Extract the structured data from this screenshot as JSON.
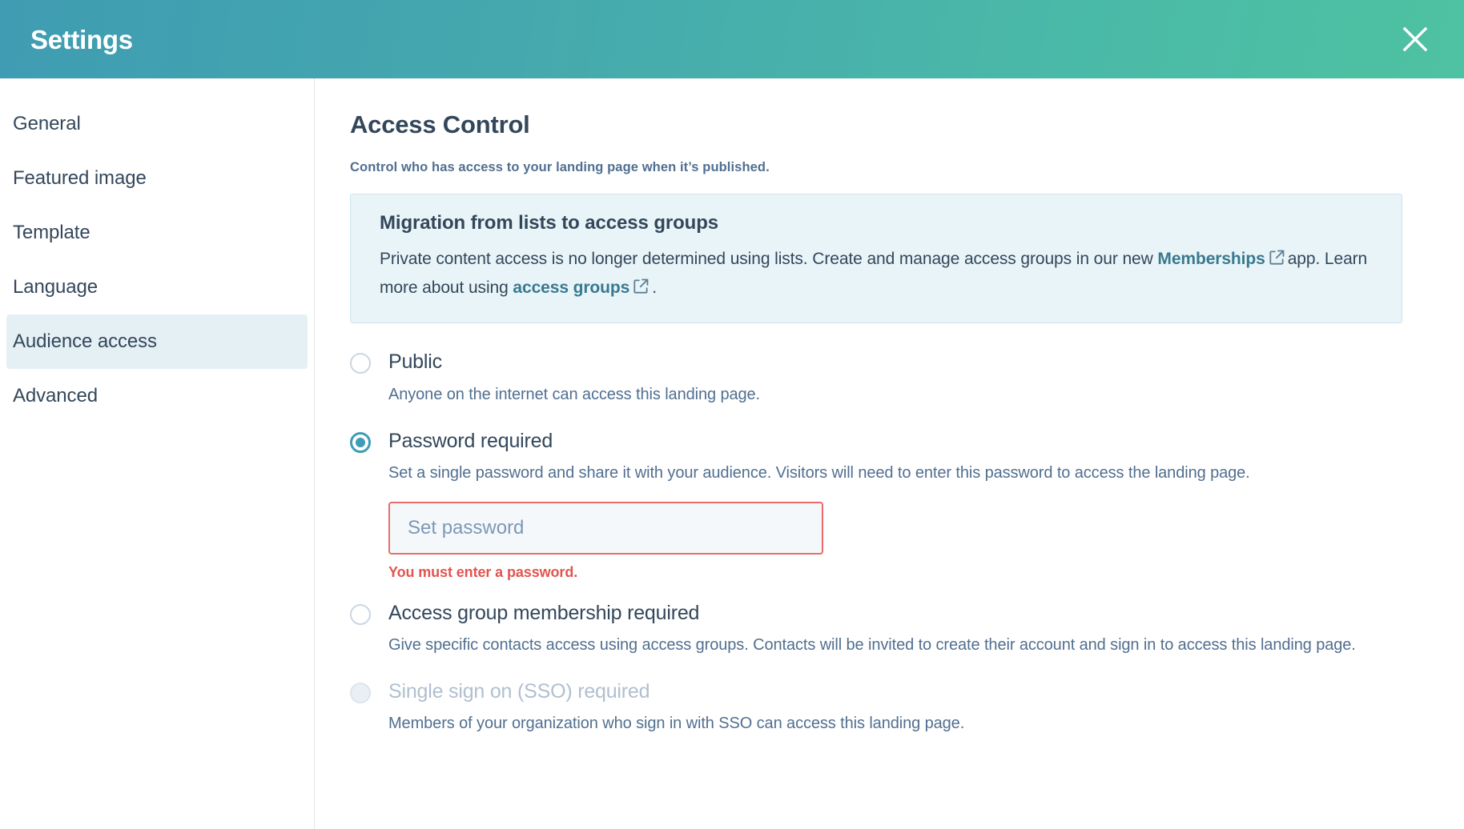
{
  "header": {
    "title": "Settings",
    "close_icon": "close-icon"
  },
  "sidebar": {
    "items": [
      {
        "label": "General",
        "active": false
      },
      {
        "label": "Featured image",
        "active": false
      },
      {
        "label": "Template",
        "active": false
      },
      {
        "label": "Language",
        "active": false
      },
      {
        "label": "Audience access",
        "active": true
      },
      {
        "label": "Advanced",
        "active": false
      }
    ]
  },
  "main": {
    "title": "Access Control",
    "subtitle": "Control who has access to your landing page when it’s published.",
    "banner": {
      "title": "Migration from lists to access groups",
      "text_part1": "Private content access is no longer determined using lists. Create and manage access groups in our new",
      "link1_label": "Memberships",
      "text_part2": "app. Learn more about using",
      "link2_label": "access groups",
      "text_part3": ".",
      "link_icon": "external-link-icon",
      "accent_color": "#39798f",
      "background_color": "#e8f4f7"
    },
    "options": [
      {
        "label": "Public",
        "description": "Anyone on the internet can access this landing page.",
        "selected": false,
        "disabled": false
      },
      {
        "label": "Password required",
        "description": "Set a single password and share it with your audience. Visitors will need to enter this password to access the landing page.",
        "selected": true,
        "disabled": false,
        "field": {
          "placeholder": "Set password",
          "value": "",
          "error": "You must enter a password.",
          "error_color": "#e2544f",
          "border_color": "#ea6b6b"
        }
      },
      {
        "label": "Access group membership required",
        "description": "Give specific contacts access using access groups. Contacts will be invited to create their account and sign in to access this landing page.",
        "selected": false,
        "disabled": false
      },
      {
        "label": "Single sign on (SSO) required",
        "description": "Members of your organization who sign in with SSO can access this landing page.",
        "selected": false,
        "disabled": true
      }
    ]
  },
  "theme": {
    "header_gradient_start": "#3f9cb2",
    "header_gradient_end": "#4ec2a2",
    "radio_selected": "#3e9cb4",
    "active_nav_bg": "#e5f0f5",
    "text_primary": "#33475b",
    "text_secondary": "#516f90"
  }
}
